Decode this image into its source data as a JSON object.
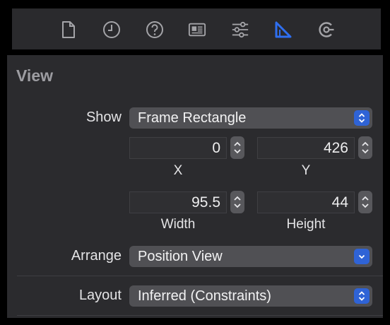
{
  "toolbar": {
    "icons": [
      "file-icon",
      "history-icon",
      "help-icon",
      "identity-icon",
      "attributes-icon",
      "size-icon",
      "connections-icon"
    ],
    "active": "size-icon",
    "accent": "#2f63d6"
  },
  "section": {
    "title": "View"
  },
  "show": {
    "label": "Show",
    "value": "Frame Rectangle"
  },
  "frame": {
    "x": {
      "value": "0",
      "label": "X"
    },
    "y": {
      "value": "426",
      "label": "Y"
    },
    "width": {
      "value": "95.5",
      "label": "Width"
    },
    "height": {
      "value": "44",
      "label": "Height"
    }
  },
  "arrange": {
    "label": "Arrange",
    "value": "Position View"
  },
  "layout": {
    "label": "Layout",
    "value": "Inferred (Constraints)"
  }
}
